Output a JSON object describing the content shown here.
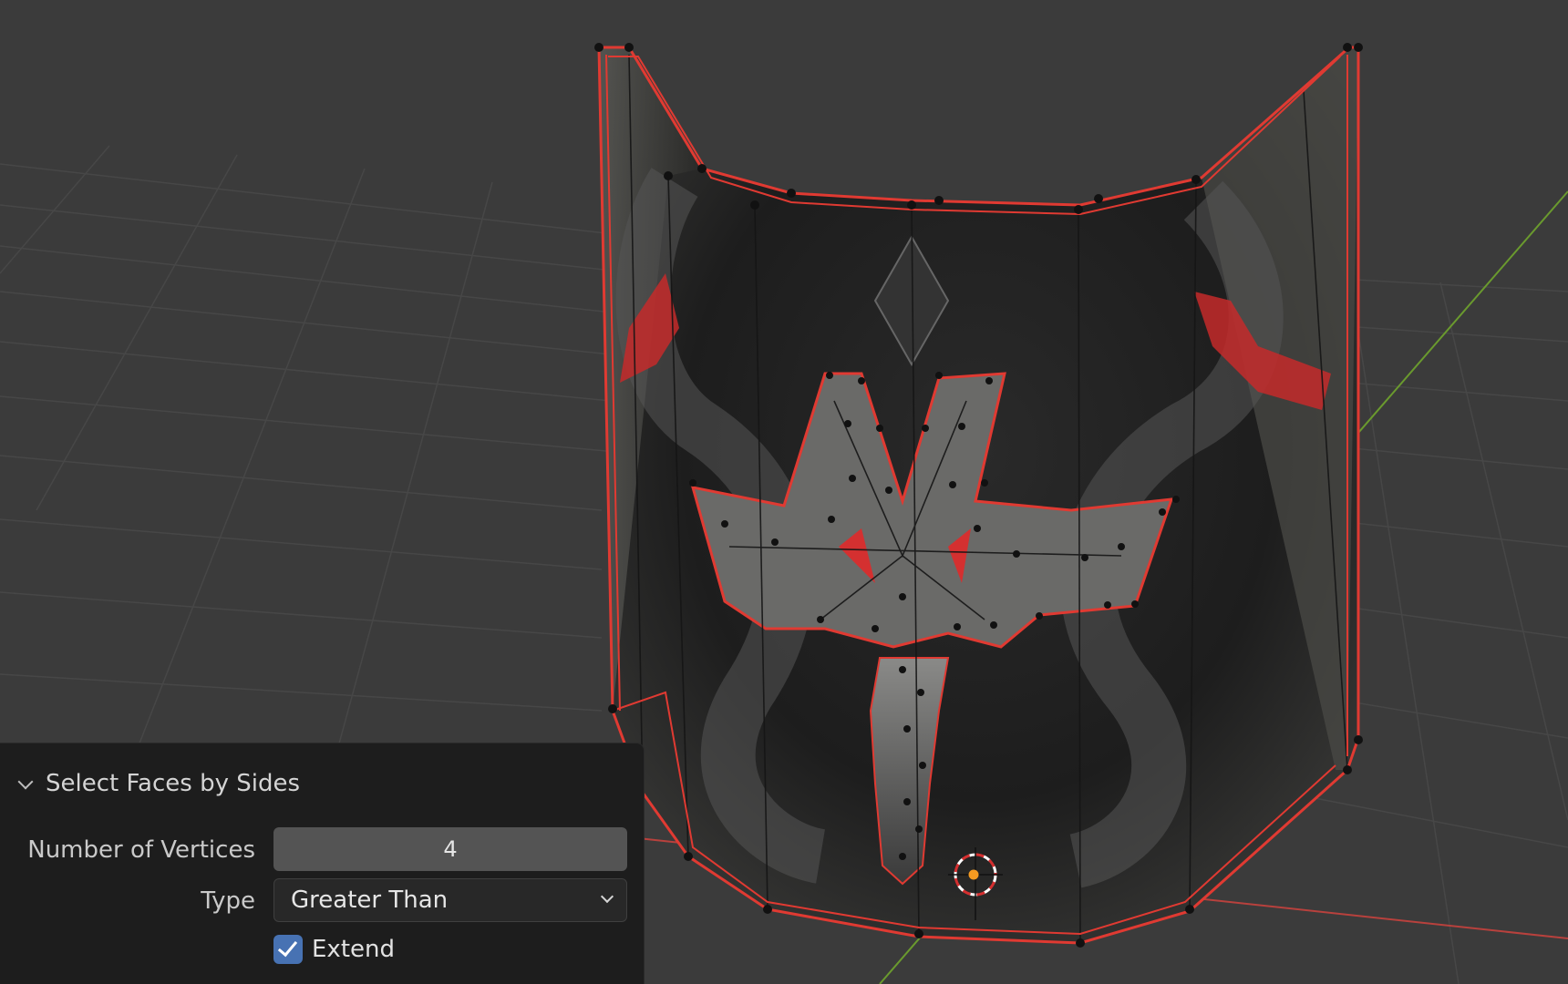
{
  "operator_panel": {
    "title": "Select Faces by Sides",
    "number_of_vertices_label": "Number of Vertices",
    "number_of_vertices_value": "4",
    "type_label": "Type",
    "type_value": "Greater Than",
    "extend_label": "Extend",
    "extend_checked": true
  },
  "viewport": {
    "background_color": "#3b3b3b",
    "selection_color": "#e03a32",
    "x_axis_color": "#b8413d",
    "y_axis_color": "#6a9a2e"
  }
}
